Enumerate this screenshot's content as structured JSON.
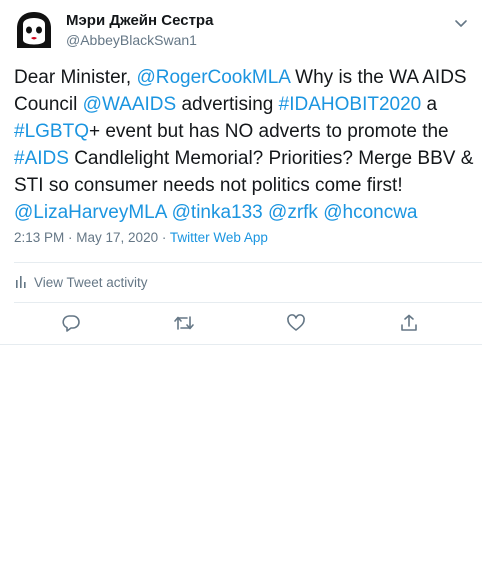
{
  "author": {
    "display_name": "Мэри Джейн Сестра",
    "handle": "@AbbeyBlackSwan1",
    "avatar_icon": "nun-face-icon"
  },
  "tweet": {
    "text_parts": [
      {
        "t": "Dear Minister, "
      },
      {
        "t": "@RogerCookMLA",
        "link": true
      },
      {
        "t": "  Why is the WA AIDS Council "
      },
      {
        "t": "@WAAIDS",
        "link": true
      },
      {
        "t": " advertising "
      },
      {
        "t": "#IDAHOBIT2020",
        "link": true
      },
      {
        "t": " a "
      },
      {
        "t": "#LGBTQ",
        "link": true
      },
      {
        "t": "+ event but has NO adverts to promote the "
      },
      {
        "t": "#AIDS",
        "link": true
      },
      {
        "t": " Candlelight Memorial? Priorities? Merge BBV & STI so consumer needs not politics come first! "
      },
      {
        "t": "@LizaHarveyMLA",
        "link": true
      },
      {
        "t": " "
      },
      {
        "t": "@tinka133",
        "link": true
      },
      {
        "t": " "
      },
      {
        "t": "@zrfk",
        "link": true
      },
      {
        "t": " "
      },
      {
        "t": "@hconcwa",
        "link": true
      }
    ],
    "time": "2:13 PM",
    "separator": " · ",
    "date": "May 17, 2020",
    "source": "Twitter Web App"
  },
  "activity": {
    "label": "View Tweet activity",
    "icon": "bar-chart-icon"
  },
  "actions": {
    "reply_icon": "reply-icon",
    "retweet_icon": "retweet-icon",
    "like_icon": "heart-icon",
    "share_icon": "share-icon"
  },
  "colors": {
    "link": "#1b95e0",
    "secondary_text": "#657786",
    "primary_text": "#14171a",
    "divider": "#e6ecf0"
  }
}
